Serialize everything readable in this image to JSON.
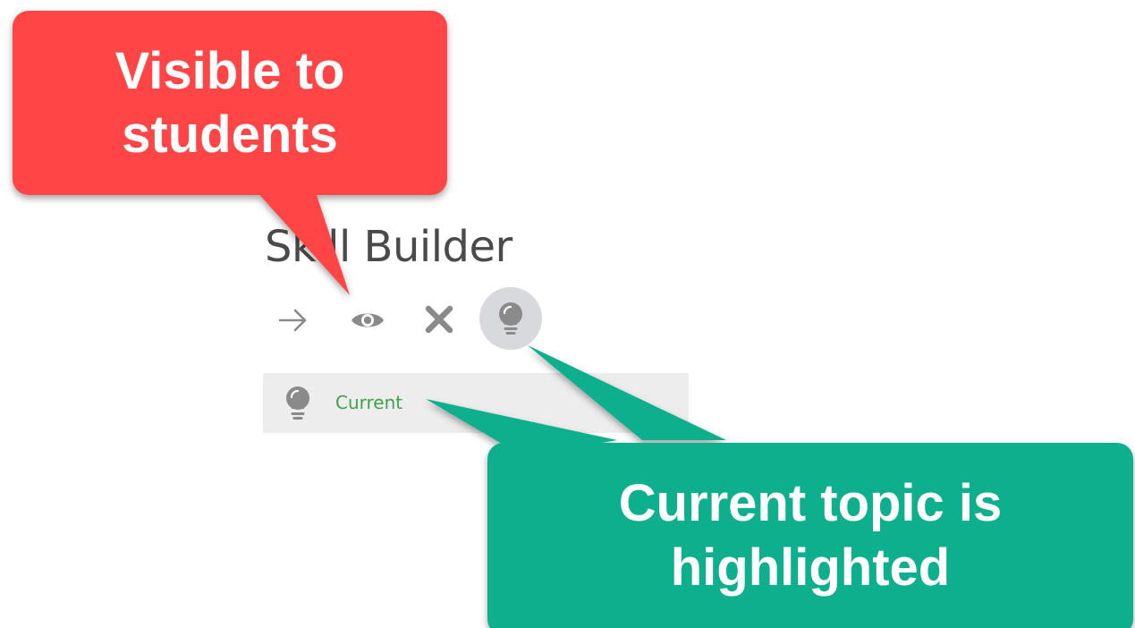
{
  "topic": {
    "title": "Skill Builder"
  },
  "toolbar": {
    "icons": [
      "arrow-right-icon",
      "eye-icon",
      "close-icon",
      "lightbulb-icon"
    ]
  },
  "current_row": {
    "label": "Current",
    "icon": "lightbulb-icon"
  },
  "callouts": {
    "visible": {
      "line1": "Visible to",
      "line2": "students"
    },
    "highlighted": {
      "line1": "Current topic is",
      "line2": "highlighted"
    }
  },
  "colors": {
    "callout_red": "#ff4444",
    "callout_green": "#0aaf8d",
    "current_label": "#3fa24a",
    "icon_gray": "#8a8a8a",
    "title": "#4a4a4a",
    "row_bg": "#ededed",
    "highlight_bg": "#d7d9dc"
  }
}
